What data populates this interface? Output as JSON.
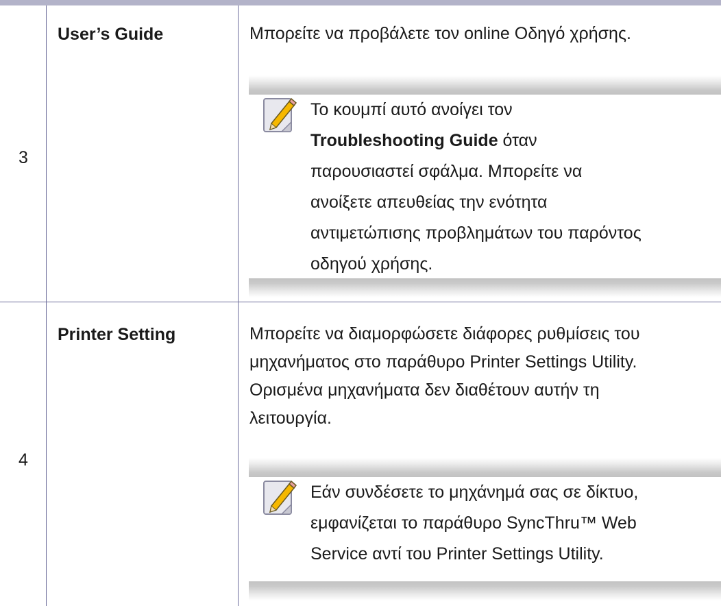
{
  "rows": [
    {
      "number": "3",
      "feature": "User’s Guide",
      "description": "Μπορείτε να προβάλετε τον online Οδηγό χρήσης.",
      "note": {
        "icon": "note-pencil-icon",
        "line1": "Το κουμπί αυτό ανοίγει τον",
        "bold": "Troubleshooting Guide",
        "after_bold": " όταν",
        "line3": "παρουσιαστεί σφάλμα. Μπορείτε να",
        "line4": "ανοίξετε απευθείας την ενότητα",
        "line5": "αντιμετώπισης προβλημάτων του παρόντος",
        "line6": "οδηγού χρήσης."
      }
    },
    {
      "number": "4",
      "feature": "Printer Setting",
      "description_lines": [
        "Μπορείτε να διαμορφώσετε διάφορες ρυθμίσεις του",
        "μηχανήματος στο παράθυρο Printer Settings Utility.",
        "Ορισμένα μηχανήματα δεν διαθέτουν αυτήν τη",
        "λειτουργία."
      ],
      "note": {
        "icon": "note-pencil-icon",
        "lines": [
          "Εάν συνδέσετε το μηχάνημά σας σε δίκτυο,",
          "εμφανίζεται το παράθυρο SyncThru™ Web",
          "Service αντί του Printer Settings Utility."
        ]
      }
    }
  ],
  "colors": {
    "rule": "#6c6c9a",
    "top_bar": "#b3b3c9",
    "note_band": "#c2c2c2",
    "icon_pencil": "#f4b400",
    "icon_paper": "#e4e4ea"
  }
}
